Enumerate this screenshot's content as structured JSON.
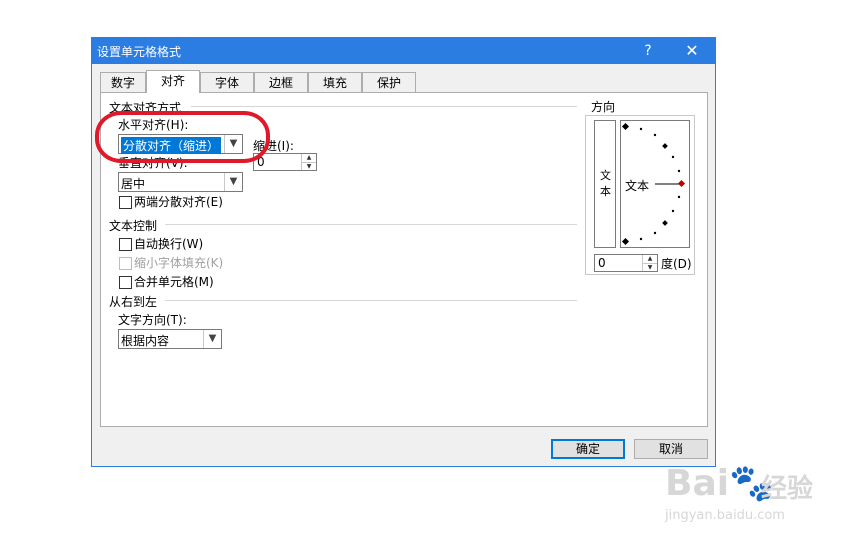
{
  "dialog": {
    "title": "设置单元格格式",
    "help": "?",
    "close": "✕",
    "ok": "确定",
    "cancel": "取消"
  },
  "tabs": [
    "数字",
    "对齐",
    "字体",
    "边框",
    "填充",
    "保护"
  ],
  "active_tab": "对齐",
  "text_alignment": {
    "group": "文本对齐方式",
    "horizontal_label": "水平对齐(H):",
    "horizontal_value": "分散对齐（缩进）",
    "indent_label": "缩进(I):",
    "indent_value": "0",
    "vertical_label": "垂直对齐(V):",
    "vertical_value": "居中",
    "justify_distributed": "两端分散对齐(E)"
  },
  "text_control": {
    "group": "文本控制",
    "wrap_text": "自动换行(W)",
    "shrink_to_fit": "缩小字体填充(K)",
    "merge_cells": "合并单元格(M)"
  },
  "rtl": {
    "group": "从右到左",
    "direction_label": "文字方向(T):",
    "direction_value": "根据内容"
  },
  "orientation": {
    "group": "方向",
    "vertical_text_1": "文",
    "vertical_text_2": "本",
    "dial_text": "文本",
    "degree_value": "0",
    "degree_label": "度(D)"
  },
  "watermark": {
    "logo": "Bai🐾",
    "cn": "经验",
    "url": "jingyan.baidu.com"
  },
  "colors": {
    "titlebar": "#2b7de1",
    "selection": "#0078d7",
    "annotation_ring": "#e0192a"
  }
}
